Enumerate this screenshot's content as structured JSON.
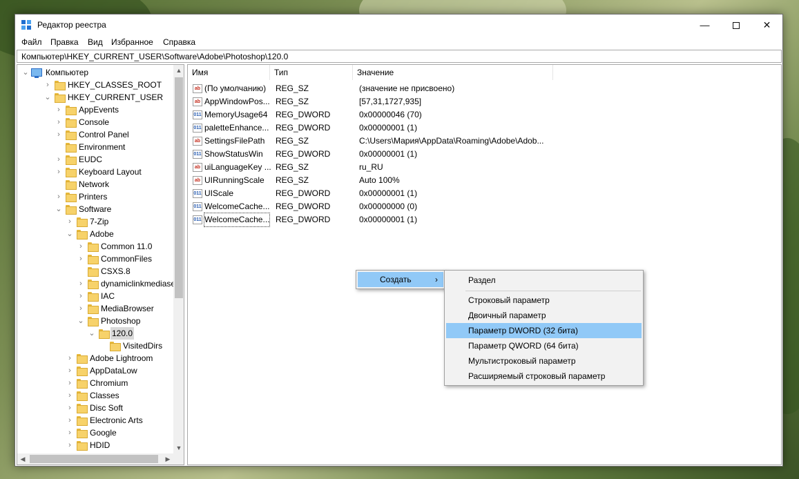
{
  "window": {
    "title": "Редактор реестра",
    "controls": {
      "minimize": "—",
      "maximize": "",
      "close": "✕"
    }
  },
  "menubar": [
    "Файл",
    "Правка",
    "Вид",
    "Избранное",
    "Справка"
  ],
  "address": "Компьютер\\HKEY_CURRENT_USER\\Software\\Adobe\\Photoshop\\120.0",
  "tree": {
    "root": "Компьютер",
    "items": [
      {
        "label": "HKEY_CLASSES_ROOT",
        "arrow": "›"
      },
      {
        "label": "HKEY_CURRENT_USER",
        "arrow": "⌄"
      },
      {
        "label": "AppEvents",
        "arrow": "›"
      },
      {
        "label": "Console",
        "arrow": "›"
      },
      {
        "label": "Control Panel",
        "arrow": "›"
      },
      {
        "label": "Environment",
        "arrow": ""
      },
      {
        "label": "EUDC",
        "arrow": "›"
      },
      {
        "label": "Keyboard Layout",
        "arrow": "›"
      },
      {
        "label": "Network",
        "arrow": ""
      },
      {
        "label": "Printers",
        "arrow": "›"
      },
      {
        "label": "Software",
        "arrow": "⌄"
      },
      {
        "label": "7-Zip",
        "arrow": "›"
      },
      {
        "label": "Adobe",
        "arrow": "⌄"
      },
      {
        "label": "Common 11.0",
        "arrow": "›"
      },
      {
        "label": "CommonFiles",
        "arrow": "›"
      },
      {
        "label": "CSXS.8",
        "arrow": ""
      },
      {
        "label": "dynamiclinkmediaserv",
        "arrow": "›"
      },
      {
        "label": "IAC",
        "arrow": "›"
      },
      {
        "label": "MediaBrowser",
        "arrow": "›"
      },
      {
        "label": "Photoshop",
        "arrow": "⌄"
      },
      {
        "label": "120.0",
        "arrow": "⌄"
      },
      {
        "label": "VisitedDirs",
        "arrow": ""
      },
      {
        "label": "Adobe Lightroom",
        "arrow": "›"
      },
      {
        "label": "AppDataLow",
        "arrow": "›"
      },
      {
        "label": "Chromium",
        "arrow": "›"
      },
      {
        "label": "Classes",
        "arrow": "›"
      },
      {
        "label": "Disc Soft",
        "arrow": "›"
      },
      {
        "label": "Electronic Arts",
        "arrow": "›"
      },
      {
        "label": "Google",
        "arrow": "›"
      },
      {
        "label": "HDID",
        "arrow": "›"
      }
    ]
  },
  "columns": {
    "name": "Имя",
    "type": "Тип",
    "value": "Значение"
  },
  "values": [
    {
      "icon": "ab",
      "name": "(По умолчанию)",
      "type": "REG_SZ",
      "data": "(значение не присвоено)"
    },
    {
      "icon": "ab",
      "name": "AppWindowPos...",
      "type": "REG_SZ",
      "data": "[57,31,1727,935]"
    },
    {
      "icon": "011",
      "name": "MemoryUsage64",
      "type": "REG_DWORD",
      "data": "0x00000046 (70)"
    },
    {
      "icon": "011",
      "name": "paletteEnhance...",
      "type": "REG_DWORD",
      "data": "0x00000001 (1)"
    },
    {
      "icon": "ab",
      "name": "SettingsFilePath",
      "type": "REG_SZ",
      "data": "C:\\Users\\Мария\\AppData\\Roaming\\Adobe\\Adob..."
    },
    {
      "icon": "011",
      "name": "ShowStatusWin",
      "type": "REG_DWORD",
      "data": "0x00000001 (1)"
    },
    {
      "icon": "ab",
      "name": "uiLanguageKey ...",
      "type": "REG_SZ",
      "data": "ru_RU"
    },
    {
      "icon": "ab",
      "name": "UIRunningScale",
      "type": "REG_SZ",
      "data": "Auto 100%"
    },
    {
      "icon": "011",
      "name": "UIScale",
      "type": "REG_DWORD",
      "data": "0x00000001 (1)"
    },
    {
      "icon": "011",
      "name": "WelcomeCache...",
      "type": "REG_DWORD",
      "data": "0x00000000 (0)"
    },
    {
      "icon": "011",
      "name": "WelcomeCache...",
      "type": "REG_DWORD",
      "data": "0x00000001 (1)"
    }
  ],
  "context_menu": {
    "create_label": "Создать",
    "arrow": "›"
  },
  "submenu": {
    "items": [
      "Раздел",
      "Строковый параметр",
      "Двоичный параметр",
      "Параметр DWORD (32 бита)",
      "Параметр QWORD (64 бита)",
      "Мультистроковый параметр",
      "Расширяемый строковый параметр"
    ],
    "highlighted_index": 3
  },
  "scroll_arrows": {
    "up": "▲",
    "down": "▼",
    "left": "◀",
    "right": "▶"
  }
}
